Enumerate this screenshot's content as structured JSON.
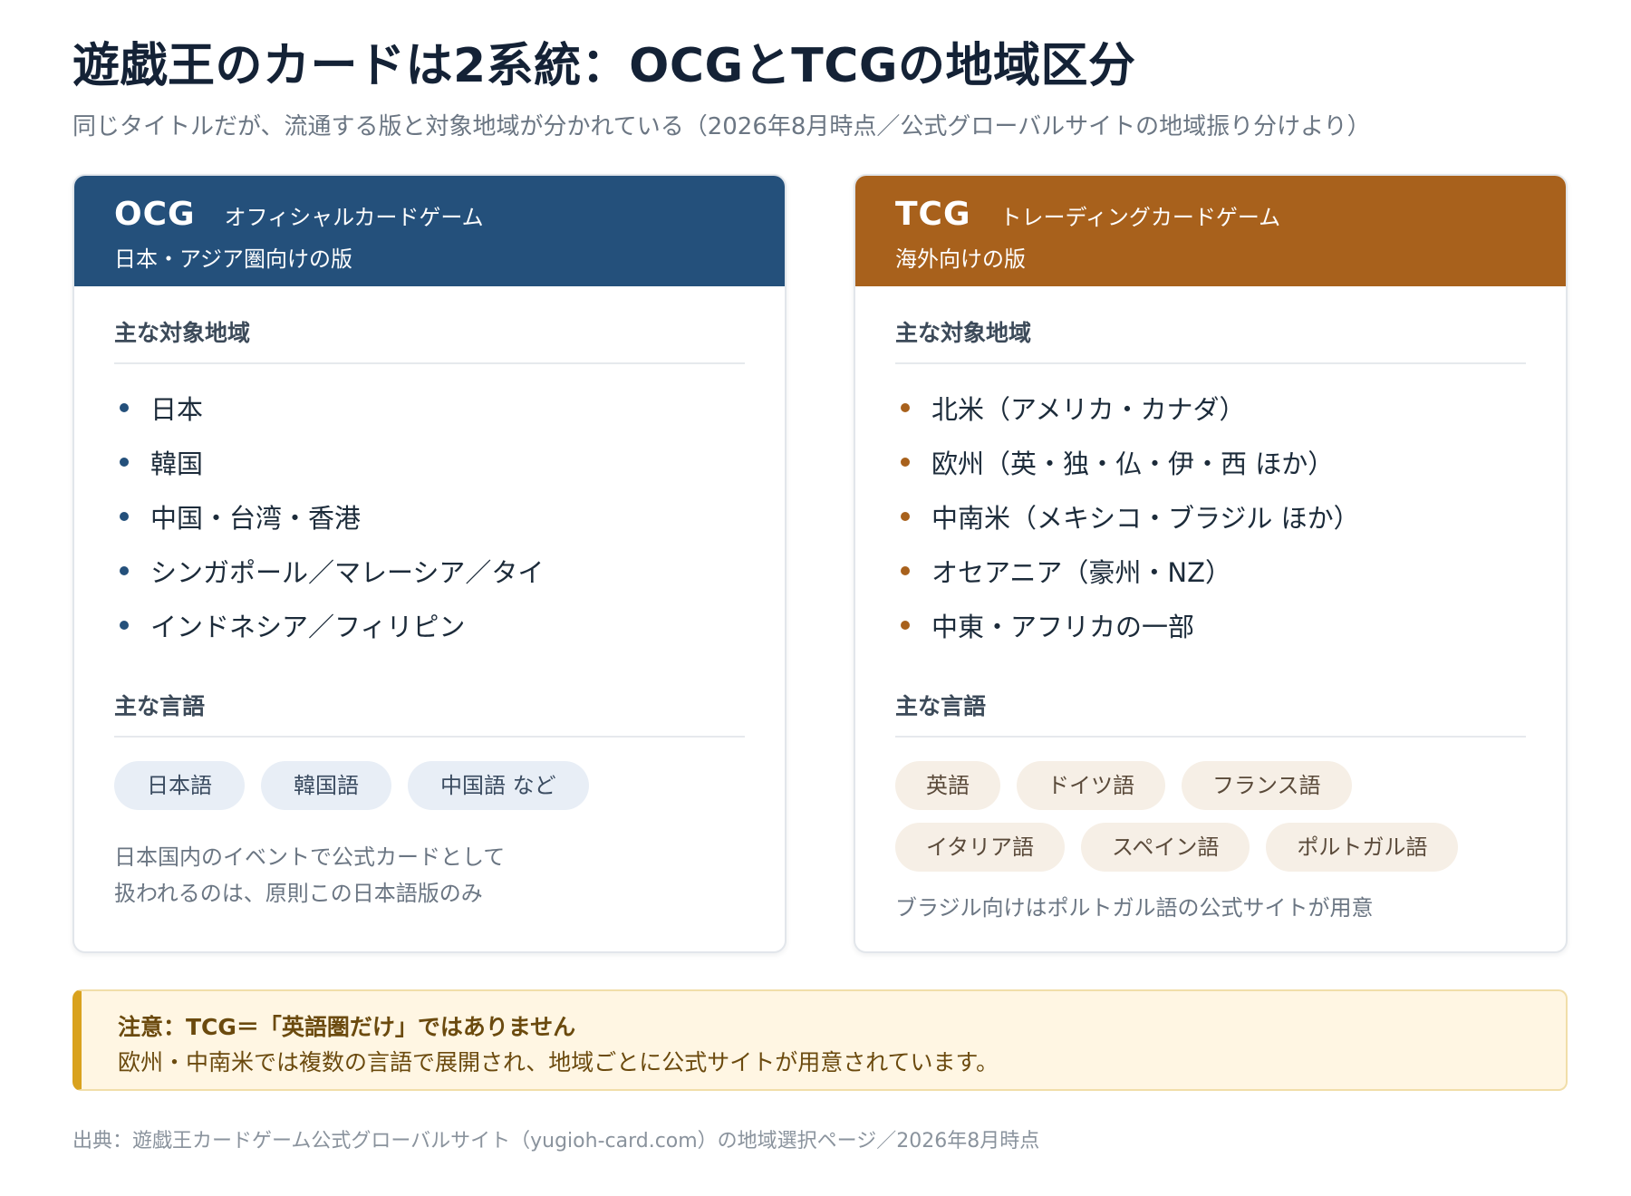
{
  "title": "遊戯王のカードは2系統：OCGとTCGの地域区分",
  "subtitle": "同じタイトルだが、流通する版と対象地域が分かれている（2026年8月時点／公式グローバルサイトの地域振り分けより）",
  "colors": {
    "ocg_accent": "#24507b",
    "tcg_accent": "#a8611c",
    "alert_accent": "#d9a21e"
  },
  "ocg": {
    "code": "OCG",
    "name": "オフィシャルカードゲーム",
    "desc": "日本・アジア圏向けの版",
    "regions_heading": "主な対象地域",
    "regions": [
      "日本",
      "韓国",
      "中国・台湾・香港",
      "シンガポール／マレーシア／タイ",
      "インドネシア／フィリピン"
    ],
    "languages_heading": "主な言語",
    "languages": [
      "日本語",
      "韓国語",
      "中国語 など"
    ],
    "note": "日本国内のイベントで公式カードとして\n扱われるのは、原則この日本語版のみ"
  },
  "tcg": {
    "code": "TCG",
    "name": "トレーディングカードゲーム",
    "desc": "海外向けの版",
    "regions_heading": "主な対象地域",
    "regions": [
      "北米（アメリカ・カナダ）",
      "欧州（英・独・仏・伊・西 ほか）",
      "中南米（メキシコ・ブラジル ほか）",
      "オセアニア（豪州・NZ）",
      "中東・アフリカの一部"
    ],
    "languages_heading": "主な言語",
    "languages": [
      "英語",
      "ドイツ語",
      "フランス語",
      "イタリア語",
      "スペイン語",
      "ポルトガル語"
    ],
    "note": "ブラジル向けはポルトガル語の公式サイトが用意"
  },
  "alert": {
    "title": "注意：TCG＝「英語圏だけ」ではありません",
    "body": "欧州・中南米では複数の言語で展開され、地域ごとに公式サイトが用意されています。"
  },
  "source": "出典：遊戯王カードゲーム公式グローバルサイト（yugioh-card.com）の地域選択ページ／2026年8月時点"
}
